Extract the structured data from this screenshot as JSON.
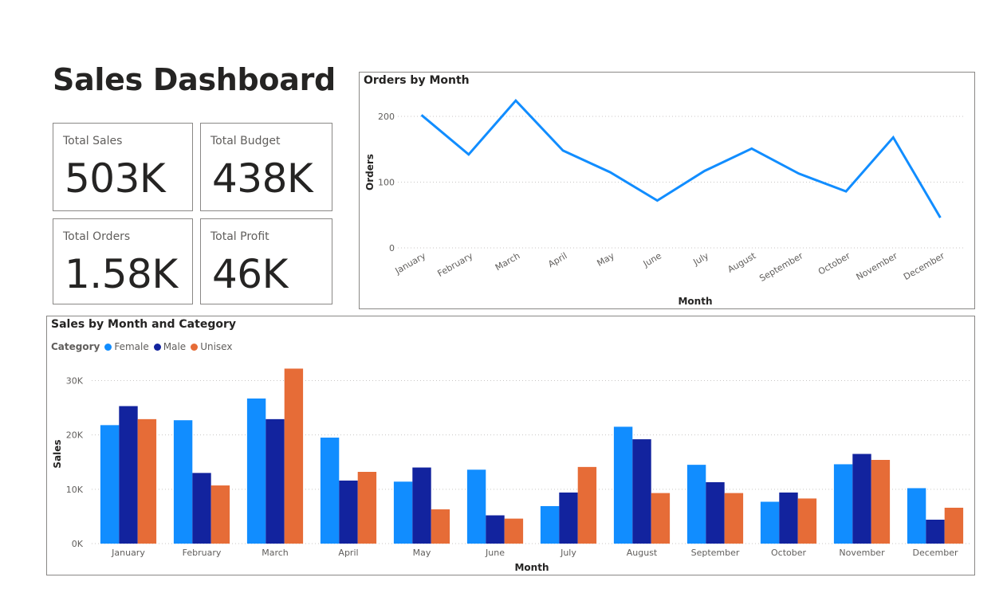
{
  "page": {
    "title": "Sales Dashboard"
  },
  "kpis": [
    {
      "label": "Total Sales",
      "value": "503K"
    },
    {
      "label": "Total Budget",
      "value": "438K"
    },
    {
      "label": "Total Orders",
      "value": "1.58K"
    },
    {
      "label": "Total Profit",
      "value": "46K"
    }
  ],
  "chart_data": [
    {
      "type": "line",
      "title": "Orders by Month",
      "xlabel": "Month",
      "ylabel": "Orders",
      "x": [
        "January",
        "February",
        "March",
        "April",
        "May",
        "June",
        "July",
        "August",
        "September",
        "October",
        "November",
        "December"
      ],
      "series": [
        {
          "values": [
            202,
            142,
            224,
            148,
            115,
            72,
            117,
            151,
            113,
            86,
            168,
            46
          ]
        }
      ],
      "ylim": [
        0,
        240
      ],
      "yticks": [
        0,
        100,
        200
      ],
      "ytick_labels": [
        "0",
        "100",
        "200"
      ],
      "grid": true,
      "line_color": "#118dff"
    },
    {
      "type": "bar",
      "title": "Sales by Month and Category",
      "xlabel": "Month",
      "ylabel": "Sales",
      "legend_title": "Category",
      "legend_position": "top-left",
      "categories": [
        "January",
        "February",
        "March",
        "April",
        "May",
        "June",
        "July",
        "August",
        "September",
        "October",
        "November",
        "December"
      ],
      "series": [
        {
          "name": "Female",
          "color": "#118dff",
          "values": [
            21800,
            22700,
            26700,
            19500,
            11400,
            13600,
            6900,
            21500,
            14500,
            7700,
            14600,
            10200
          ]
        },
        {
          "name": "Male",
          "color": "#12239e",
          "values": [
            25300,
            13000,
            22900,
            11600,
            14000,
            5200,
            9400,
            19200,
            11300,
            9400,
            16500,
            4400
          ]
        },
        {
          "name": "Unisex",
          "color": "#e66c37",
          "values": [
            22900,
            10700,
            32200,
            13200,
            6300,
            4600,
            14100,
            9300,
            9300,
            8300,
            15400,
            6600
          ]
        }
      ],
      "ylim": [
        0,
        33000
      ],
      "yticks": [
        0,
        10000,
        20000,
        30000
      ],
      "ytick_labels": [
        "0K",
        "10K",
        "20K",
        "30K"
      ],
      "grid": true
    }
  ]
}
